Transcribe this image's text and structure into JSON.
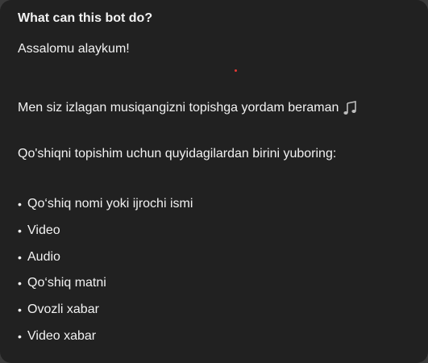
{
  "dialog": {
    "title": "What can this bot do?",
    "greeting": "Assalomu alaykum!",
    "intro": "Men siz izlagan musiqangizni topishga yordam beraman",
    "intro_icon": "musical-note-icon",
    "prompt": "Qo'shiqni topishim uchun quyidagilardan birini yuboring:",
    "bullet_glyph": "•",
    "options": [
      "Qo‘shiq nomi yoki ijrochi ismi",
      "Video",
      "Audio",
      "Qo‘shiq matni",
      "Ovozli xabar",
      "Video xabar"
    ]
  },
  "colors": {
    "card_background": "#212121",
    "text": "#f2f2f2"
  }
}
